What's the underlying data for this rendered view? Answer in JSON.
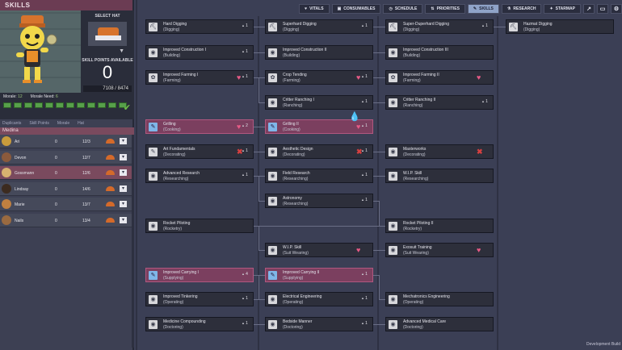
{
  "header": {
    "title": "SKILLS"
  },
  "hat": {
    "label": "SELECT HAT"
  },
  "skill_points": {
    "label": "SKILL POINTS AVAILABLE",
    "value": "0",
    "xp": "7108 / 8474"
  },
  "morale": {
    "morale_label": "Morale:",
    "morale_value": "12",
    "need_label": "Morale Need:",
    "need_value": "6"
  },
  "list": {
    "headers": [
      "Duplicants",
      "Skill Points",
      "Morale",
      "Hat"
    ],
    "sort_label": "Medina",
    "rows": [
      {
        "name": "Ari",
        "points": "0",
        "morale": "12/3",
        "selected": false,
        "avatar": "#c89b3c"
      },
      {
        "name": "Devon",
        "points": "0",
        "morale": "12/7",
        "selected": false,
        "avatar": "#8a5a3c"
      },
      {
        "name": "Gossmann",
        "points": "0",
        "morale": "12/6",
        "selected": true,
        "avatar": "#d8b270"
      },
      {
        "name": "Lindsay",
        "points": "0",
        "morale": "14/6",
        "selected": false,
        "avatar": "#3c2b20"
      },
      {
        "name": "Marie",
        "points": "0",
        "morale": "13/7",
        "selected": false,
        "avatar": "#c08040"
      },
      {
        "name": "Nails",
        "points": "0",
        "morale": "13/4",
        "selected": false,
        "avatar": "#9a6a40"
      }
    ]
  },
  "tabs": [
    {
      "label": "VITALS",
      "icon": "heart-icon",
      "glyph": "♥",
      "active": false
    },
    {
      "label": "CONSUMABLES",
      "icon": "consumables-icon",
      "glyph": "▣",
      "active": false
    },
    {
      "label": "SCHEDULE",
      "icon": "clock-icon",
      "glyph": "◷",
      "active": false
    },
    {
      "label": "PRIORITIES",
      "icon": "priorities-icon",
      "glyph": "⇅",
      "active": false
    },
    {
      "label": "SKILLS",
      "icon": "wrench-icon",
      "glyph": "✎",
      "active": true
    },
    {
      "label": "RESEARCH",
      "icon": "research-icon",
      "glyph": "⚗",
      "active": false
    },
    {
      "label": "STARMAP",
      "icon": "starmap-icon",
      "glyph": "✦",
      "active": false
    }
  ],
  "tab_icons": [
    {
      "icon": "graph-icon",
      "glyph": "↗"
    },
    {
      "icon": "screen-icon",
      "glyph": "▭"
    },
    {
      "icon": "gear-icon",
      "glyph": "⚙"
    }
  ],
  "skills": [
    {
      "id": "hard-digging",
      "name": "Hard Digging",
      "group": "(Digging)",
      "count": "1"
    },
    {
      "id": "superhard-digging",
      "name": "Superhard Digging",
      "group": "(Digging)",
      "count": "1"
    },
    {
      "id": "superduperhard-digging",
      "name": "Super-Duperhard Digging",
      "group": "(Digging)",
      "count": "1"
    },
    {
      "id": "hazmat-digging",
      "name": "Hazmat Digging",
      "group": "(Digging)",
      "count": ""
    },
    {
      "id": "improved-construction-1",
      "name": "Improved Construction I",
      "group": "(Building)",
      "count": "1"
    },
    {
      "id": "improved-construction-2",
      "name": "Improved Construction II",
      "group": "(Building)",
      "count": ""
    },
    {
      "id": "improved-construction-3",
      "name": "Improved Construction III",
      "group": "(Building)",
      "count": ""
    },
    {
      "id": "improved-farming-1",
      "name": "Improved Farming I",
      "group": "(Farming)",
      "count": "1",
      "mark": "heart"
    },
    {
      "id": "crop-tending",
      "name": "Crop Tending",
      "group": "(Farming)",
      "count": "1",
      "mark": "heart"
    },
    {
      "id": "improved-farming-2",
      "name": "Improved Farming II",
      "group": "(Farming)",
      "count": "",
      "mark": "heart"
    },
    {
      "id": "critter-ranching-1",
      "name": "Critter Ranching I",
      "group": "(Ranching)",
      "count": "1"
    },
    {
      "id": "critter-ranching-2",
      "name": "Critter Ranching II",
      "group": "(Ranching)",
      "count": "1"
    },
    {
      "id": "grilling",
      "name": "Grilling",
      "group": "(Cooking)",
      "count": "2",
      "mark": "heart",
      "highlight": true
    },
    {
      "id": "grilling-2",
      "name": "Grilling II",
      "group": "(Cooking)",
      "count": "1",
      "mark": "heart",
      "highlight": true
    },
    {
      "id": "art-fundamentals",
      "name": "Art Fundamentals",
      "group": "(Decorating)",
      "count": "1",
      "mark": "x"
    },
    {
      "id": "aesthetic-design",
      "name": "Aesthetic Design",
      "group": "(Decorating)",
      "count": "1",
      "mark": "x"
    },
    {
      "id": "masterworks",
      "name": "Masterworks",
      "group": "(Decorating)",
      "count": "",
      "mark": "x"
    },
    {
      "id": "advanced-research",
      "name": "Advanced Research",
      "group": "(Researching)",
      "count": "1"
    },
    {
      "id": "field-research",
      "name": "Field Research",
      "group": "(Researching)",
      "count": "1"
    },
    {
      "id": "wip-skill-research",
      "name": "W.I.P. Skill",
      "group": "(Researching)",
      "count": ""
    },
    {
      "id": "astronomy",
      "name": "Astronomy",
      "group": "(Researching)",
      "count": "1"
    },
    {
      "id": "rocket-piloting",
      "name": "Rocket Piloting",
      "group": "(Rocketry)",
      "count": ""
    },
    {
      "id": "rocket-piloting-2",
      "name": "Rocket Piloting II",
      "group": "(Rocketry)",
      "count": ""
    },
    {
      "id": "wip-skill-suit",
      "name": "W.I.P. Skill",
      "group": "(Suit Wearing)",
      "count": "",
      "mark": "heart"
    },
    {
      "id": "exosuit-training",
      "name": "Exosuit Training",
      "group": "(Suit Wearing)",
      "count": "",
      "mark": "heart"
    },
    {
      "id": "improved-carrying-1",
      "name": "Improved Carrying I",
      "group": "(Supplying)",
      "count": "4",
      "highlight": true
    },
    {
      "id": "improved-carrying-2",
      "name": "Improved Carrying II",
      "group": "(Supplying)",
      "count": "1",
      "highlight": true
    },
    {
      "id": "improved-tinkering",
      "name": "Improved Tinkering",
      "group": "(Operating)",
      "count": "1"
    },
    {
      "id": "electrical-engineering",
      "name": "Electrical Engineering",
      "group": "(Operating)",
      "count": "1"
    },
    {
      "id": "mechatronics-engineering",
      "name": "Mechatronics Engineering",
      "group": "(Operating)",
      "count": ""
    },
    {
      "id": "medicine-compounding",
      "name": "Medicine Compounding",
      "group": "(Doctoring)",
      "count": "1"
    },
    {
      "id": "bedside-manner",
      "name": "Bedside Manner",
      "group": "(Doctoring)",
      "count": "1"
    },
    {
      "id": "advanced-medical-care",
      "name": "Advanced Medical Care",
      "group": "(Doctoring)",
      "count": ""
    }
  ],
  "watermark": "Development Build"
}
